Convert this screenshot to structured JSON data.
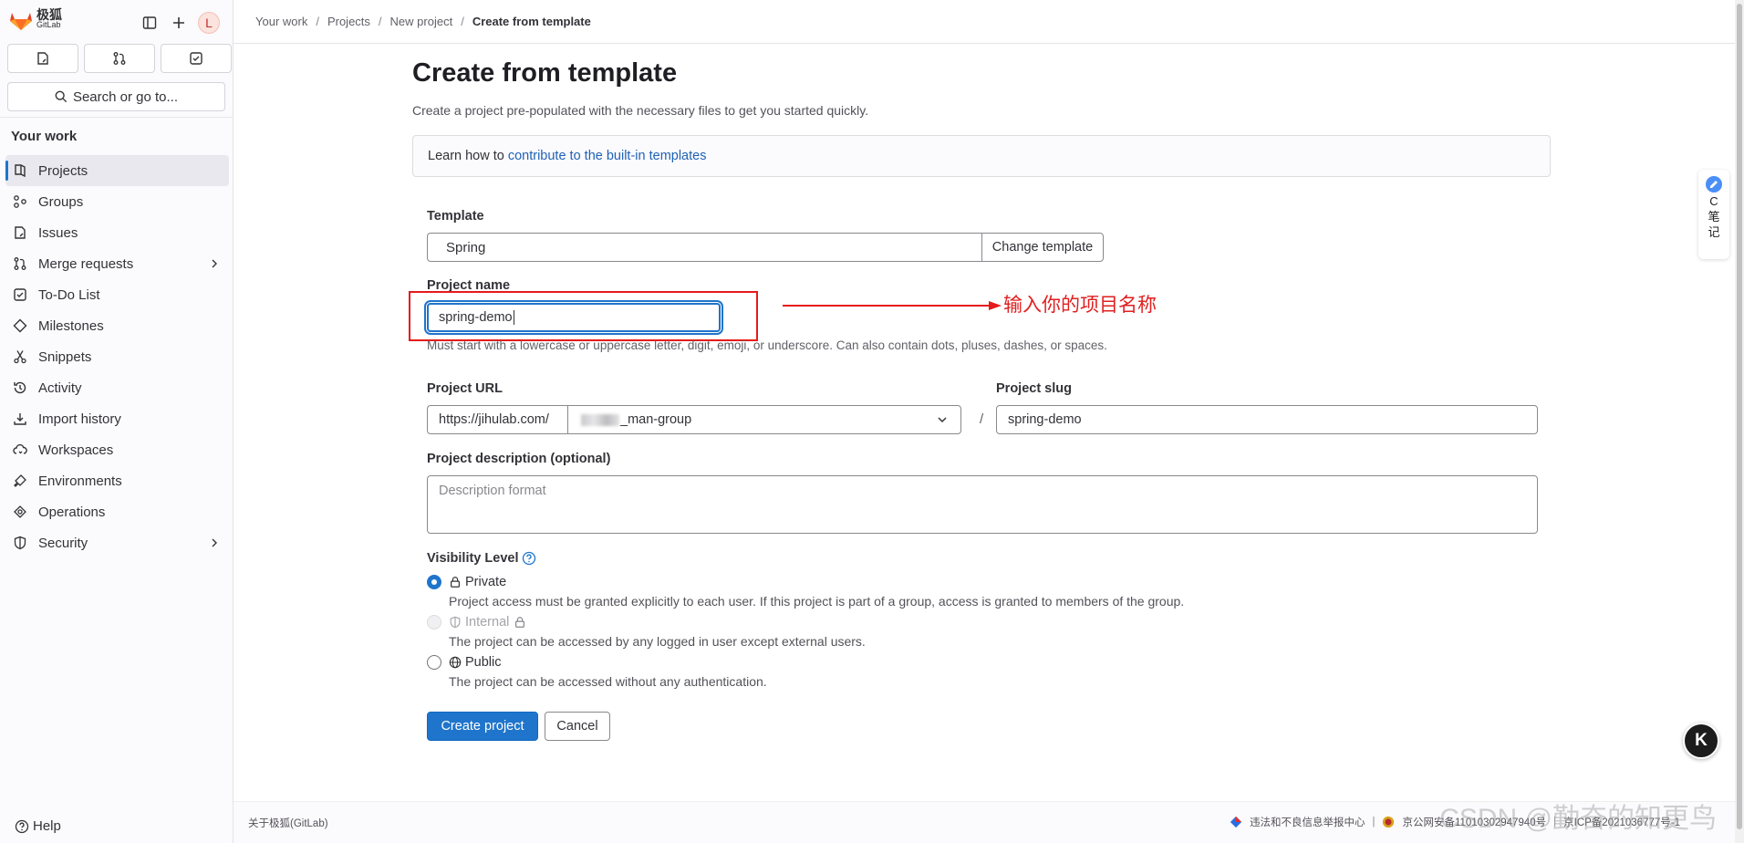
{
  "sidebar": {
    "logo_cn": "极狐",
    "logo_en": "GitLab",
    "avatar_letter": "L",
    "search_label": "Search or go to...",
    "section_title": "Your work",
    "items": [
      {
        "label": "Projects",
        "icon": "project-icon"
      },
      {
        "label": "Groups",
        "icon": "group-icon"
      },
      {
        "label": "Issues",
        "icon": "issues-icon"
      },
      {
        "label": "Merge requests",
        "icon": "merge-request-icon"
      },
      {
        "label": "To-Do List",
        "icon": "todo-icon"
      },
      {
        "label": "Milestones",
        "icon": "milestone-icon"
      },
      {
        "label": "Snippets",
        "icon": "snippet-icon"
      },
      {
        "label": "Activity",
        "icon": "history-icon"
      },
      {
        "label": "Import history",
        "icon": "import-icon"
      },
      {
        "label": "Workspaces",
        "icon": "workspace-icon"
      },
      {
        "label": "Environments",
        "icon": "environment-icon"
      },
      {
        "label": "Operations",
        "icon": "deployments-icon"
      },
      {
        "label": "Security",
        "icon": "shield-icon"
      }
    ],
    "help_label": "Help"
  },
  "breadcrumb": [
    "Your work",
    "Projects",
    "New project",
    "Create from template"
  ],
  "page": {
    "title": "Create from template",
    "description": "Create a project pre-populated with the necessary files to get you started quickly.",
    "info_prefix": "Learn how to",
    "info_link": "contribute to the built-in templates"
  },
  "form": {
    "template_label": "Template",
    "template_value": "Spring",
    "change_template_label": "Change template",
    "project_name_label": "Project name",
    "project_name_value": "spring-demo",
    "project_name_help": "Must start with a lowercase or uppercase letter, digit, emoji, or underscore. Can also contain dots, pluses, dashes, or spaces.",
    "project_url_label": "Project URL",
    "url_prefix": "https://jihulab.com/",
    "namespace_value": "_man-group",
    "slash": "/",
    "project_slug_label": "Project slug",
    "project_slug_value": "spring-demo",
    "description_label": "Project description (optional)",
    "description_placeholder": "Description format",
    "visibility_label": "Visibility Level",
    "visibility": [
      {
        "label": "Private",
        "help": "Project access must be granted explicitly to each user. If this project is part of a group, access is granted to members of the group.",
        "state": "checked"
      },
      {
        "label": "Internal",
        "help": "The project can be accessed by any logged in user except external users.",
        "state": "disabled"
      },
      {
        "label": "Public",
        "help": "The project can be accessed without any authentication.",
        "state": "unchecked"
      }
    ],
    "create_label": "Create project",
    "cancel_label": "Cancel"
  },
  "annotation": {
    "text": "输入你的项目名称",
    "color": "#e02020"
  },
  "footer": {
    "left": "关于极狐(GitLab)",
    "report": "违法和不良信息举报中心",
    "police": "京公网安备11010302947940号",
    "icp": "京ICP备2021036777号-1",
    "watermark": "CSDN @勤奋的知更鸟"
  },
  "side_widget": {
    "label_chars": [
      "C",
      "笔",
      "记"
    ],
    "k_button": "K"
  },
  "colors": {
    "primary": "#1f75cb",
    "link": "#1f63b5",
    "annotation_red": "#e51b1b"
  }
}
